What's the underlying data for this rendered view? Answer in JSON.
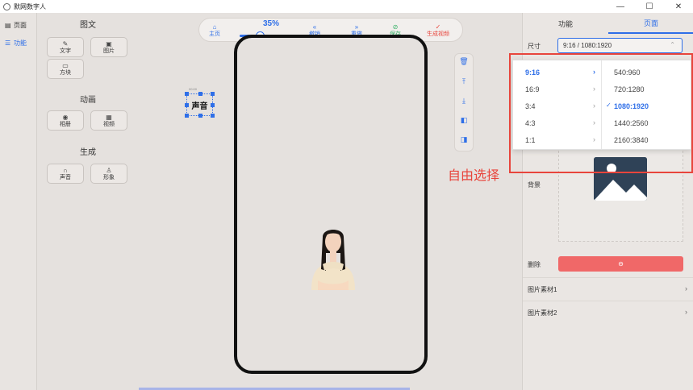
{
  "window": {
    "title": "默网数字人",
    "controls": [
      "—",
      "☐",
      "✕"
    ]
  },
  "leftnav": {
    "items": [
      {
        "label": "页面",
        "icon": "page-icon",
        "active": false
      },
      {
        "label": "功能",
        "icon": "function-icon",
        "active": true
      }
    ]
  },
  "tools": {
    "graphic_title": "图文",
    "graphic": [
      {
        "label": "文字",
        "icon": "edit-icon"
      },
      {
        "label": "图片",
        "icon": "image-icon"
      },
      {
        "label": "方块",
        "icon": "block-icon"
      }
    ],
    "animation_title": "动画",
    "animation": [
      {
        "label": "相册",
        "icon": "camera-icon"
      },
      {
        "label": "视频",
        "icon": "video-icon"
      }
    ],
    "generate_title": "生成",
    "generate": [
      {
        "label": "声音",
        "icon": "headphones-icon"
      },
      {
        "label": "形象",
        "icon": "person-icon"
      }
    ]
  },
  "toolbar": {
    "home": "主页",
    "zoom": "35%",
    "zoom_value": 0.35,
    "undo": "撤销",
    "redo": "重做",
    "save": "保存",
    "generate": "生成视频"
  },
  "canvas": {
    "text_element": "声音",
    "text_element_tag": "00:00"
  },
  "annotation": "自由选择",
  "rightpanel": {
    "tabs": [
      "功能",
      "页面"
    ],
    "active_tab": "页面",
    "size_label": "尺寸",
    "size_value": "9:16 / 1080:1920",
    "background_label": "背景",
    "delete_label": "删除",
    "materials": [
      "图片素材1",
      "图片素材2"
    ]
  },
  "dropdown": {
    "ratios": [
      "9:16",
      "16:9",
      "3:4",
      "4:3",
      "1:1"
    ],
    "selected_ratio": "9:16",
    "resolutions": [
      "540:960",
      "720:1280",
      "1080:1920",
      "1440:2560",
      "2160:3840"
    ],
    "selected_resolution": "1080:1920"
  },
  "colors": {
    "accent": "#2f6fe8",
    "danger": "#f06868",
    "annotation": "#e8453c",
    "save": "#3bb36a"
  }
}
